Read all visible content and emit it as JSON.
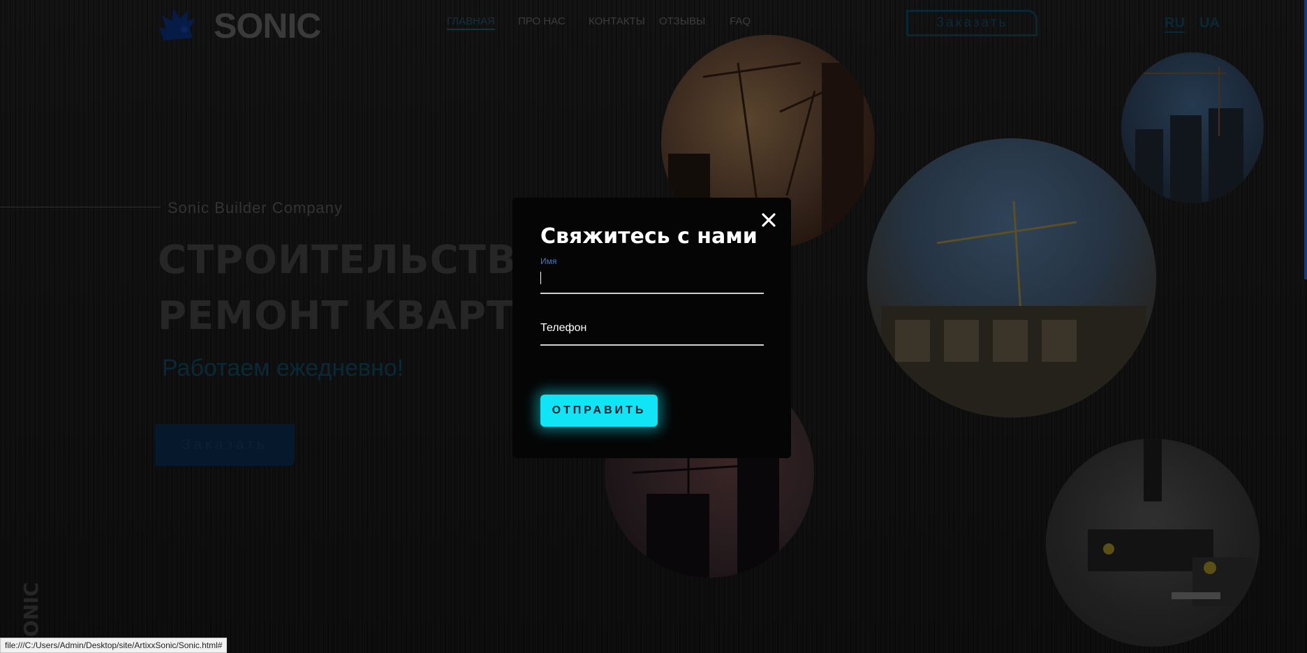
{
  "brand": {
    "logo_icon": "hedgehog-icon",
    "name": "SONIC"
  },
  "nav": {
    "items": [
      {
        "label": "ГЛАВНАЯ",
        "active": true
      },
      {
        "label": "ПРО НАС"
      },
      {
        "label": "КОНТАКТЫ"
      },
      {
        "label": "ОТЗЫВЫ"
      },
      {
        "label": "FAQ"
      }
    ]
  },
  "header": {
    "order_label": "Заказать",
    "languages": [
      "RU",
      "UA"
    ],
    "active_language": "RU"
  },
  "hero": {
    "company": "Sonic Builder Company",
    "headline_line1": "СТРОИТЕЛЬСТВО ДОМОВ",
    "headline_line2": "РЕМОНТ КВАРТИР",
    "tagline": "Работаем ежедневно!",
    "order_label": "Заказать",
    "side_text": "SONIC"
  },
  "modal": {
    "title": "Свяжитесь с нами",
    "close_icon": "close-icon",
    "name_label": "Имя",
    "name_value": "",
    "phone_placeholder": "Телефон",
    "phone_value": "",
    "submit_label": "ОТПРАВИТЬ"
  },
  "status_bar": {
    "url": "file:///C:/Users/Admin/Desktop/site/ArtixxSonic/Sonic.html#"
  },
  "colors": {
    "accent": "#11e5f5",
    "nav_active": "#1b4d63",
    "label_blue": "#3a7bd5",
    "modal_bg": "#050505"
  }
}
